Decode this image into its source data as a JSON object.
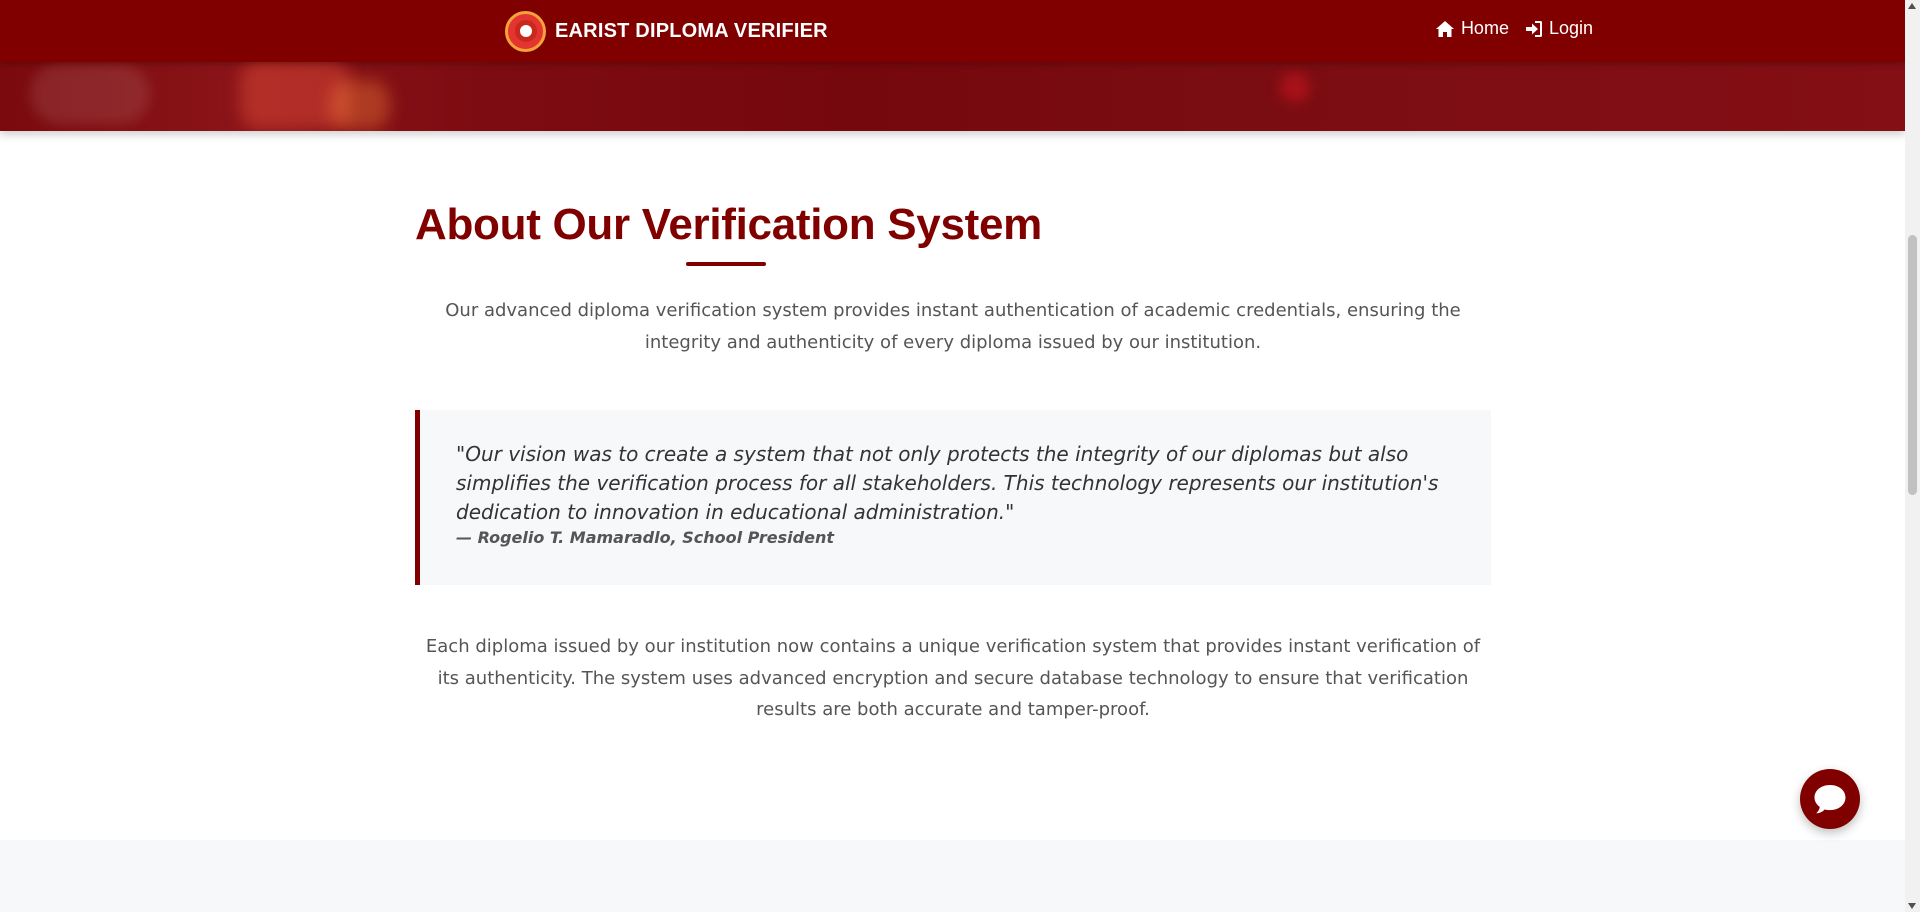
{
  "navbar": {
    "brand_text": "EARIST DIPLOMA VERIFIER",
    "links": [
      {
        "label": "Home",
        "icon": "home-icon"
      },
      {
        "label": "Login",
        "icon": "login-icon"
      }
    ]
  },
  "about": {
    "title": "About Our Verification System",
    "intro": "Our advanced diploma verification system provides instant authentication of academic credentials, ensuring the integrity and authenticity of every diploma issued by our institution.",
    "quote": {
      "text": "\"Our vision was to create a system that not only protects the integrity of our diplomas but also simplifies the verification process for all stakeholders. This technology represents our institution's dedication to innovation in educational administration.\"",
      "author": "— Rogelio T. Mamaradlo, School President"
    },
    "body": "Each diploma issued by our institution now contains a unique verification system that provides instant verification of its authenticity. The system uses advanced encryption and secure database technology to ensure that verification results are both accurate and tamper-proof."
  },
  "chat": {
    "icon": "chat-bubble-icon"
  },
  "colors": {
    "primary": "#800000",
    "quote_bg": "#f7f8fa",
    "text": "#555555"
  }
}
